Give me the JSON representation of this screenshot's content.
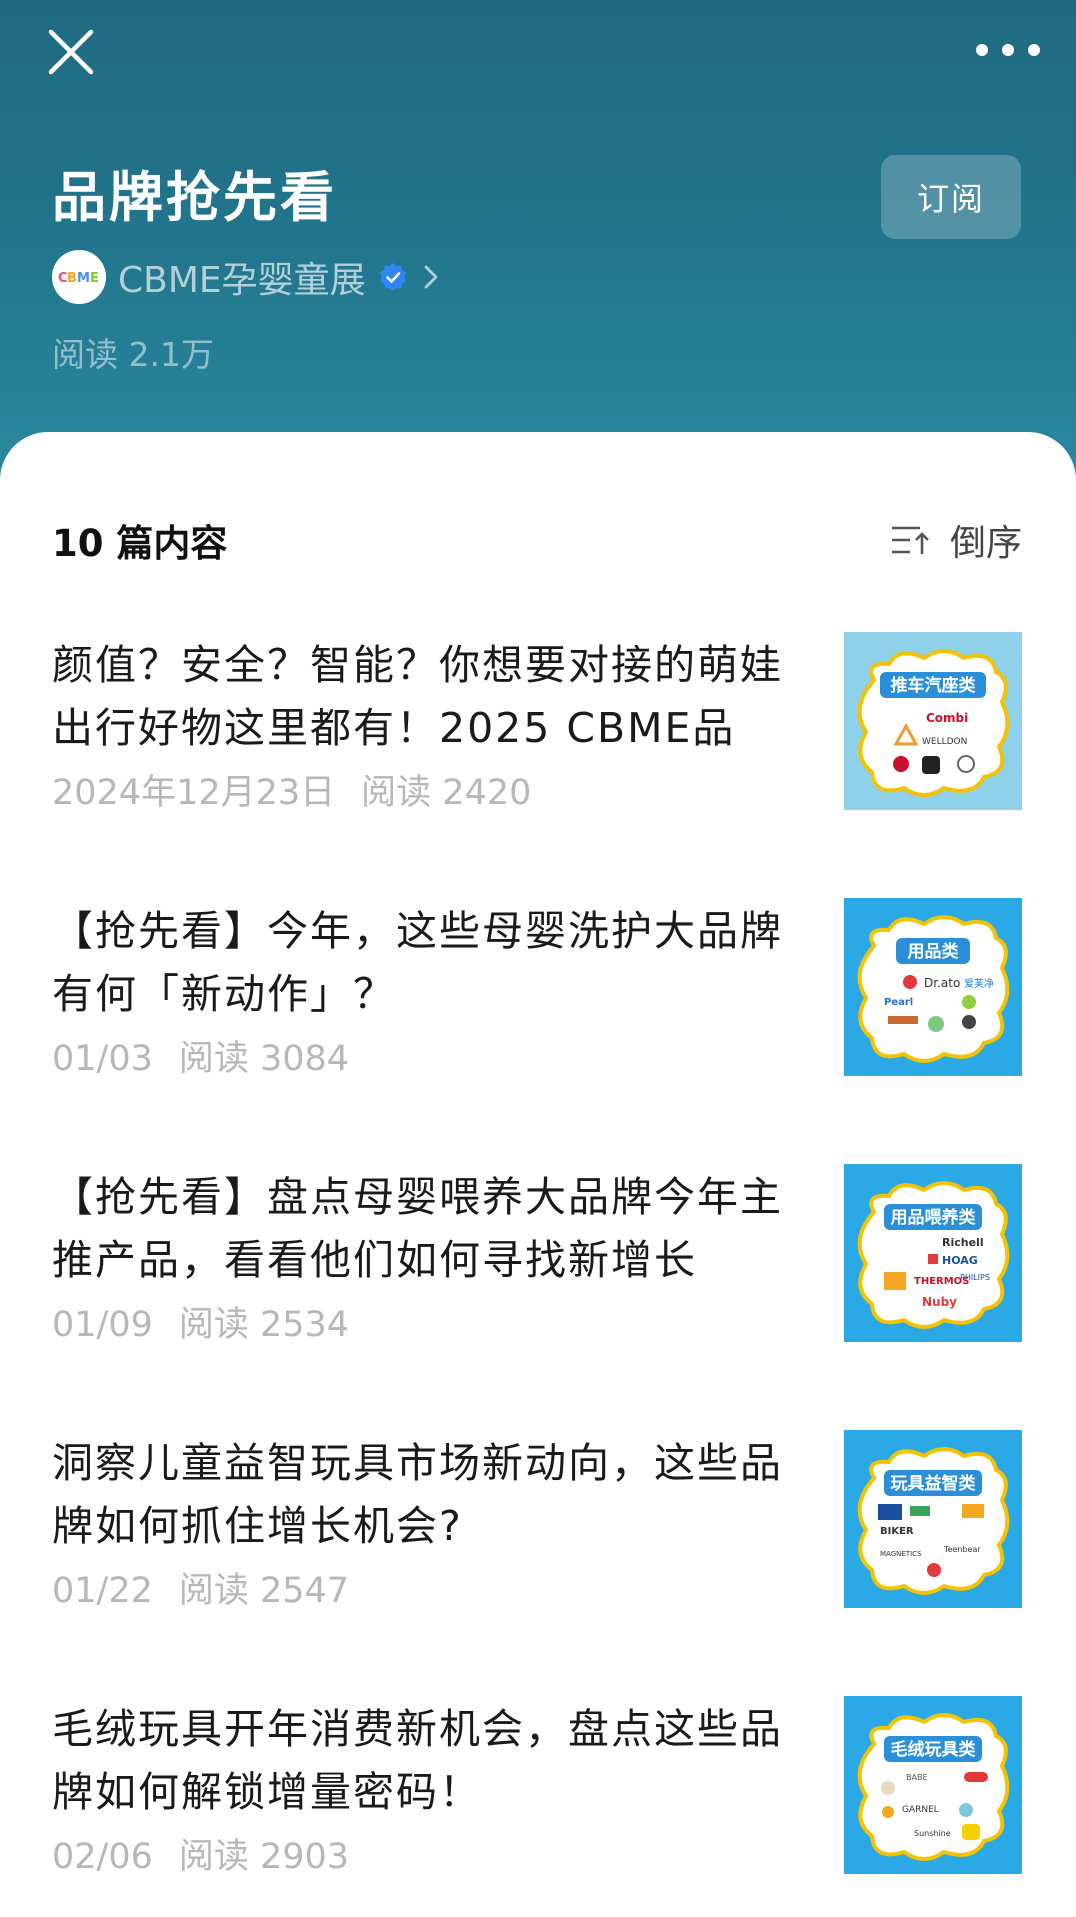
{
  "header": {
    "title": "品牌抢先看",
    "subscribe_label": "订阅",
    "account": {
      "name": "CBME孕婴童展",
      "avatar_text": "CBME",
      "verified": true
    },
    "read_count": "阅读 2.1万"
  },
  "list": {
    "count_label": "10 篇内容",
    "sort_label": "倒序"
  },
  "articles": [
    {
      "title": "颜值？安全？智能？你想要对接的萌娃出行好物这里都有！2025 CBME品",
      "date": "2024年12月23日",
      "reads": "阅读 2420",
      "thumb": {
        "category": "推车汽座类",
        "bg": "#8fd1e8",
        "brands": [
          "Combi",
          "WELLDON"
        ]
      }
    },
    {
      "title": "【抢先看】今年，这些母婴洗护大品牌有何「新动作」？",
      "date": "01/03",
      "reads": "阅读 3084",
      "thumb": {
        "category": "用品类",
        "bg": "#2aa9e6",
        "brands": [
          "Dr.ato",
          "爱芙净",
          "Pearl"
        ]
      }
    },
    {
      "title": "【抢先看】盘点母婴喂养大品牌今年主推产品，看看他们如何寻找新增长",
      "date": "01/09",
      "reads": "阅读 2534",
      "thumb": {
        "category": "用品喂养类",
        "bg": "#2aa9e6",
        "brands": [
          "Richell",
          "HOAG",
          "THERMOS",
          "PHILIPS",
          "Nuby"
        ]
      }
    },
    {
      "title": "洞察儿童益智玩具市场新动向，这些品牌如何抓住增长机会?",
      "date": "01/22",
      "reads": "阅读 2547",
      "thumb": {
        "category": "玩具益智类",
        "bg": "#2aa9e6",
        "brands": [
          "BIKER",
          "MAGNETICS",
          "Teenbear"
        ]
      }
    },
    {
      "title": "毛绒玩具开年消费新机会，盘点这些品牌如何解锁增量密码！",
      "date": "02/06",
      "reads": "阅读 2903",
      "thumb": {
        "category": "毛绒玩具类",
        "bg": "#2aa9e6",
        "brands": [
          "BABE",
          "GARNEL",
          "Sunshine"
        ]
      }
    }
  ]
}
